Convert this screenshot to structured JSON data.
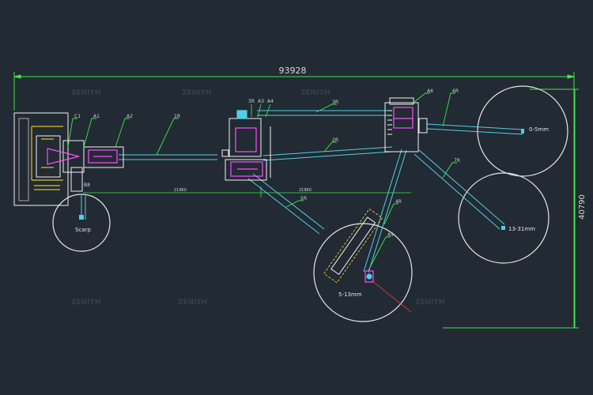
{
  "dimensions": {
    "overall_width": "93928",
    "overall_height": "40790",
    "span_left": "21960",
    "span_right": "21960"
  },
  "stockpiles": {
    "scarp": "Scarp",
    "fine": "0-5mm",
    "medium": "13-31mm",
    "small": "5-13mm"
  },
  "callouts": {
    "c1": "C1",
    "a1": "A1",
    "a2": "A2",
    "b1": "1R",
    "a3": "3R",
    "a3b": "A3",
    "a4": "A4",
    "r3": "3R",
    "r2": "2R",
    "a6": "A6",
    "r6": "6R",
    "r7": "7R",
    "r5": "5R",
    "r4": "4R",
    "a5": "A5",
    "b8": "B8"
  },
  "watermark": "ZENITH",
  "colors": {
    "background": "#222a33",
    "conveyor": "#4fd0e6",
    "dimension": "#3fe64a",
    "equipment": "#f2f2f2",
    "machine": "#ff4cff",
    "hopper": "#e0c020",
    "accent_red": "#ff3b3b"
  }
}
